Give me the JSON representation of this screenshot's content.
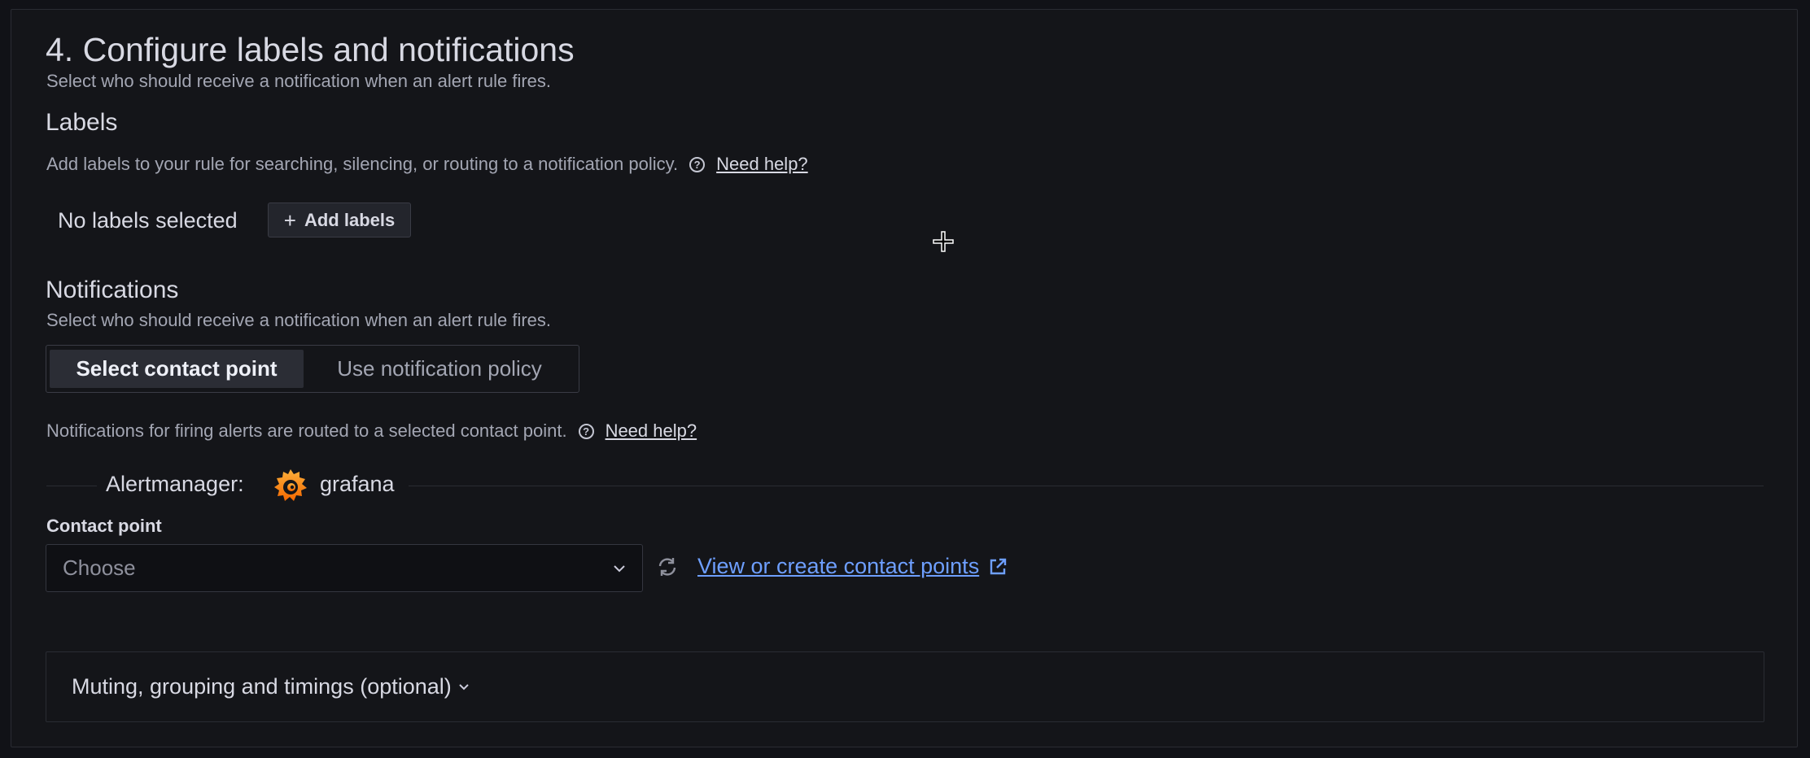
{
  "section": {
    "title": "4. Configure labels and notifications",
    "subtitle": "Select who should receive a notification when an alert rule fires."
  },
  "labels": {
    "heading": "Labels",
    "description": "Add labels to your rule for searching, silencing, or routing to a notification policy.",
    "help_link": "Need help?",
    "empty_text": "No labels selected",
    "add_button": "Add labels"
  },
  "notifications": {
    "heading": "Notifications",
    "subtitle": "Select who should receive a notification when an alert rule fires.",
    "tabs": [
      {
        "label": "Select contact point",
        "active": true
      },
      {
        "label": "Use notification policy",
        "active": false
      }
    ],
    "routing_text": "Notifications for firing alerts are routed to a selected contact point.",
    "help_link": "Need help?",
    "alertmanager_label": "Alertmanager:",
    "alertmanager_value": "grafana",
    "contact_point_label": "Contact point",
    "contact_point_placeholder": "Choose",
    "contact_points_link": "View or create contact points"
  },
  "advanced": {
    "label": "Muting, grouping and timings (optional)"
  },
  "colors": {
    "background": "#111217",
    "link": "#6e9fff",
    "logo_orange": "#f46800",
    "logo_yellow": "#fbb03b"
  }
}
